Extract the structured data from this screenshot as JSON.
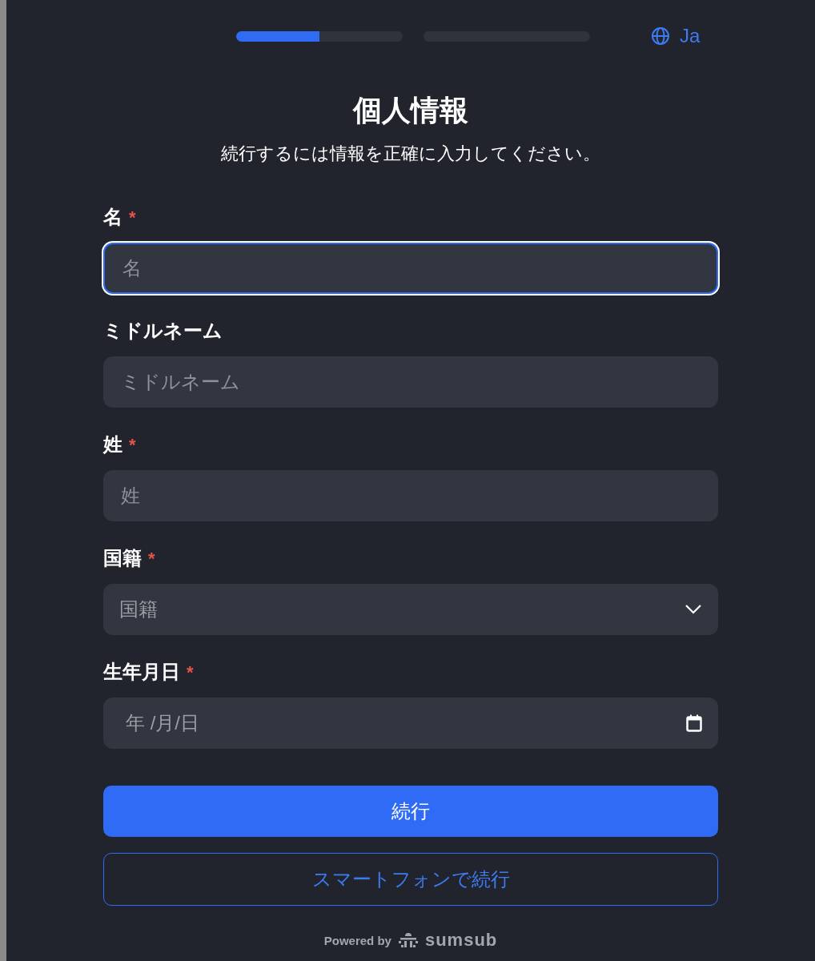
{
  "progress": [
    {
      "level": 0.5
    },
    {
      "level": 0
    }
  ],
  "language": {
    "label": "Ja"
  },
  "title": "個人情報",
  "subtitle": "続行するには情報を正確に入力してください。",
  "fields": [
    {
      "kind": "text",
      "label": "名",
      "required": true,
      "placeholder": "名",
      "focused": true
    },
    {
      "kind": "text",
      "label": "ミドルネーム",
      "required": false,
      "placeholder": "ミドルネーム",
      "focused": false
    },
    {
      "kind": "text",
      "label": "姓",
      "required": true,
      "placeholder": "姓",
      "focused": false
    },
    {
      "kind": "select",
      "label": "国籍",
      "required": true,
      "placeholder": "国籍",
      "focused": false
    },
    {
      "kind": "date",
      "label": "生年月日",
      "required": true,
      "placeholder": "年 /月/日",
      "focused": false
    }
  ],
  "required_mark": "*",
  "buttons": [
    {
      "kind": "primary",
      "label": "続行"
    },
    {
      "kind": "outline",
      "label": "スマートフォンで続行"
    }
  ],
  "footer": {
    "powered_by": "Powered by",
    "brand": "sumsub"
  }
}
